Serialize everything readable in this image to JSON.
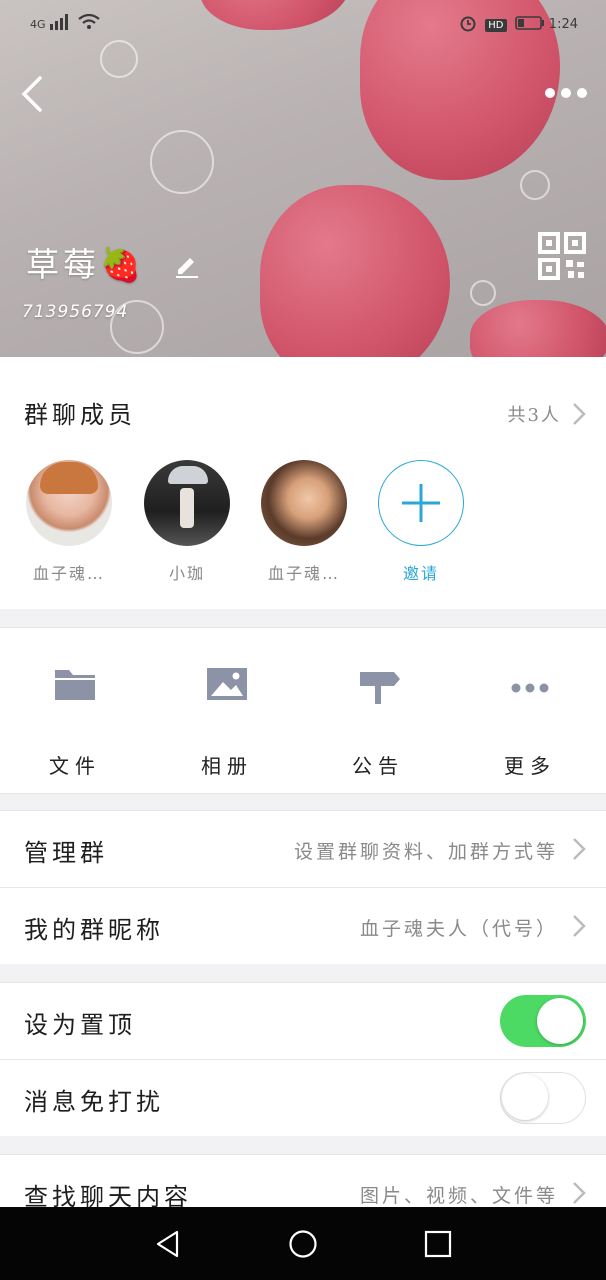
{
  "status_bar": {
    "network": "4G",
    "time": "1:24",
    "hd": "HD"
  },
  "group": {
    "name": "草莓🍓",
    "id": "713956794"
  },
  "members": {
    "title": "群聊成员",
    "count": "共3人",
    "list": [
      {
        "name": "血子魂…"
      },
      {
        "name": "小珈"
      },
      {
        "name": "血子魂…"
      }
    ],
    "invite_label": "邀请"
  },
  "tools": [
    {
      "label": "文件",
      "icon": "folder-icon"
    },
    {
      "label": "相册",
      "icon": "image-icon"
    },
    {
      "label": "公告",
      "icon": "signpost-icon"
    },
    {
      "label": "更多",
      "icon": "more-icon"
    }
  ],
  "settings": {
    "manage": {
      "label": "管理群",
      "value": "设置群聊资料、加群方式等"
    },
    "nickname": {
      "label": "我的群昵称",
      "value": "血子魂夫人（代号）"
    },
    "pin": {
      "label": "设为置顶",
      "on": true
    },
    "mute": {
      "label": "消息免打扰",
      "on": false
    },
    "search": {
      "label": "查找聊天内容",
      "value": "图片、视频、文件等"
    }
  },
  "colors": {
    "accent": "#2aa7d6",
    "toggle_on": "#4cd964",
    "toggle_off": "#ffffff",
    "icon_gray": "#8d93a6"
  }
}
